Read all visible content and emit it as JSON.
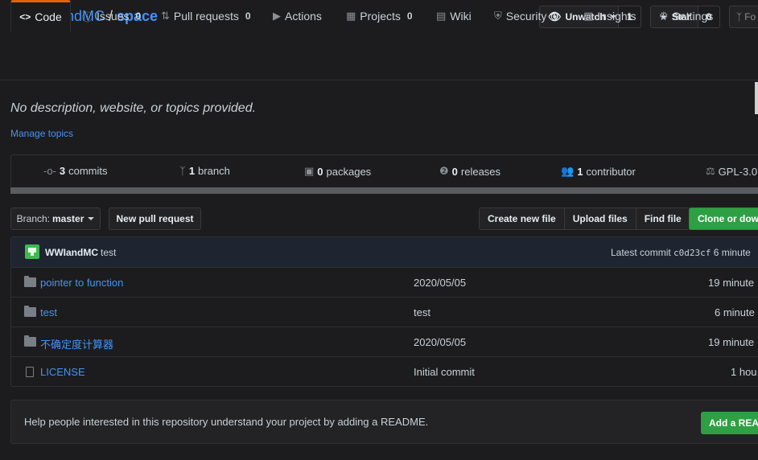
{
  "repo": {
    "owner": "WWIandMC",
    "separator": "/",
    "name": "space"
  },
  "header_actions": {
    "watch": {
      "label": "Unwatch",
      "count": "1"
    },
    "star": {
      "label": "Star",
      "count": "0"
    },
    "fork": {
      "label": "Fo"
    }
  },
  "tabs": [
    {
      "label": "Code",
      "count": ""
    },
    {
      "label": "Issues",
      "count": "0"
    },
    {
      "label": "Pull requests",
      "count": "0"
    },
    {
      "label": "Actions",
      "count": ""
    },
    {
      "label": "Projects",
      "count": "0"
    },
    {
      "label": "Wiki",
      "count": ""
    },
    {
      "label": "Security",
      "count": "0"
    },
    {
      "label": "Insights",
      "count": ""
    },
    {
      "label": "Settings",
      "count": ""
    }
  ],
  "description": "No description, website, or topics provided.",
  "manage_topics": "Manage topics",
  "summary": {
    "commits": {
      "count": "3",
      "label": "commits"
    },
    "branch": {
      "count": "1",
      "label": "branch"
    },
    "packages": {
      "count": "0",
      "label": "packages"
    },
    "releases": {
      "count": "0",
      "label": "releases"
    },
    "contributor": {
      "count": "1",
      "label": "contributor"
    },
    "license": "GPL-3.0"
  },
  "toolbar": {
    "branch_prefix": "Branch:",
    "branch_name": "master",
    "new_pull_request": "New pull request",
    "create_new_file": "Create new file",
    "upload_files": "Upload files",
    "find_file": "Find file",
    "clone": "Clone or dow"
  },
  "latest_commit": {
    "author": "WWIandMC",
    "message": "test",
    "label": "Latest commit",
    "sha": "c0d23cf",
    "age": "6 minute"
  },
  "files": [
    {
      "type": "folder",
      "name": "pointer to function",
      "message": "2020/05/05",
      "age": "19 minute"
    },
    {
      "type": "folder",
      "name": "test",
      "message": "test",
      "age": "6 minute"
    },
    {
      "type": "folder",
      "name": "不确定度计算器",
      "message": "2020/05/05",
      "age": "19 minute"
    },
    {
      "type": "file",
      "name": "LICENSE",
      "message": "Initial commit",
      "age": "1 hou"
    }
  ],
  "readme_prompt": {
    "text": "Help people interested in this repository understand your project by adding a README.",
    "button": "Add a REA"
  }
}
